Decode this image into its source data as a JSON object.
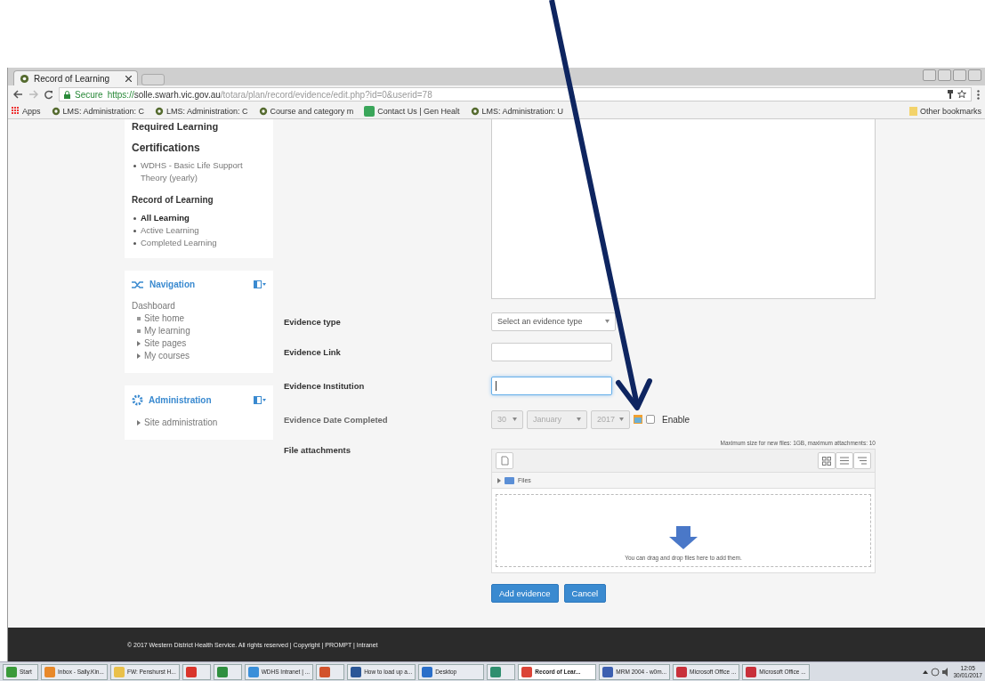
{
  "browser": {
    "tabs": [
      {
        "label": "Record of Learning",
        "selected": true
      }
    ],
    "url_host": "https://solle.swarh.vic.gov.au",
    "url_path": "/totara/plan/record/evidence/edit.php?id=0&userid=78",
    "secure_label": "Secure",
    "bookmarks": [
      {
        "label": "Apps",
        "kind": "apps"
      },
      {
        "label": "LMS: Administration: C",
        "kind": "site"
      },
      {
        "label": "LMS: Administration: C",
        "kind": "site"
      },
      {
        "label": "Course and category m",
        "kind": "site"
      },
      {
        "label": "Contact Us | Gen Healt",
        "kind": "contact"
      },
      {
        "label": "LMS: Administration: U",
        "kind": "site"
      }
    ],
    "other_bookmarks": "Other bookmarks"
  },
  "sidebar": {
    "required_heading": "Required Learning",
    "certifications": {
      "title": "Certifications",
      "items": [
        "WDHS - Basic Life Support Theory (yearly)"
      ]
    },
    "record": {
      "title": "Record of Learning",
      "items": [
        {
          "label": "All Learning",
          "selected": true
        },
        {
          "label": "Active Learning",
          "selected": false
        },
        {
          "label": "Completed Learning",
          "selected": false
        }
      ]
    },
    "navigation": {
      "title": "Navigation",
      "root": "Dashboard",
      "items": [
        {
          "label": "Site home",
          "kind": "leaf"
        },
        {
          "label": "My learning",
          "kind": "leaf"
        },
        {
          "label": "Site pages",
          "kind": "branch"
        },
        {
          "label": "My courses",
          "kind": "branch"
        }
      ]
    },
    "administration": {
      "title": "Administration",
      "items": [
        {
          "label": "Site administration",
          "kind": "branch"
        }
      ]
    }
  },
  "form": {
    "evidence_type": {
      "label": "Evidence type",
      "placeholder": "Select an evidence type"
    },
    "evidence_link": {
      "label": "Evidence Link"
    },
    "evidence_institution": {
      "label": "Evidence Institution",
      "focused": true
    },
    "date_completed": {
      "label": "Evidence Date Completed",
      "day": "30",
      "month": "January",
      "year": "2017",
      "enabled": false,
      "enable_label": "Enable"
    },
    "attachments": {
      "label": "File attachments",
      "limits": "Maximum size for new files: 1GB, maximum attachments: 10",
      "folder": "Files",
      "drop_hint": "You can drag and drop files here to add them."
    },
    "buttons": [
      "Add evidence",
      "Cancel"
    ]
  },
  "footer": "© 2017 Western District Health Service. All rights reserved | Copyright | PROMPT | Intranet",
  "taskbar": {
    "start": "Start",
    "items": [
      {
        "label": "Inbox - Sally.Kin...",
        "color": "#e8892a",
        "selected": false
      },
      {
        "label": "FW: Penshurst H...",
        "color": "#e9c04a",
        "selected": false
      },
      {
        "color": "#d9342b",
        "selected": false
      },
      {
        "color": "#2f8f3f",
        "selected": false
      },
      {
        "label": "WDHS Intranet | ...",
        "color": "#3a8fd9",
        "selected": false
      },
      {
        "color": "#d2532c",
        "selected": false
      },
      {
        "label": "How to load up a...",
        "color": "#2b5797",
        "selected": false
      },
      {
        "label": "Desktop",
        "color": "#2a6fc9",
        "selected": false
      },
      {
        "color": "#2f8f6f",
        "selected": false
      },
      {
        "label": "Record of Lear...",
        "color": "#db4437",
        "selected": true
      },
      {
        "label": "MRM 2004 - w0m...",
        "color": "#3c5fb0",
        "selected": false
      },
      {
        "label": "Microsoft Office ...",
        "color": "#c8303a",
        "selected": false
      },
      {
        "label": "Microsoft Office ...",
        "color": "#c8303a",
        "selected": false
      }
    ],
    "time": "12:05",
    "date": "30/01/2017"
  }
}
